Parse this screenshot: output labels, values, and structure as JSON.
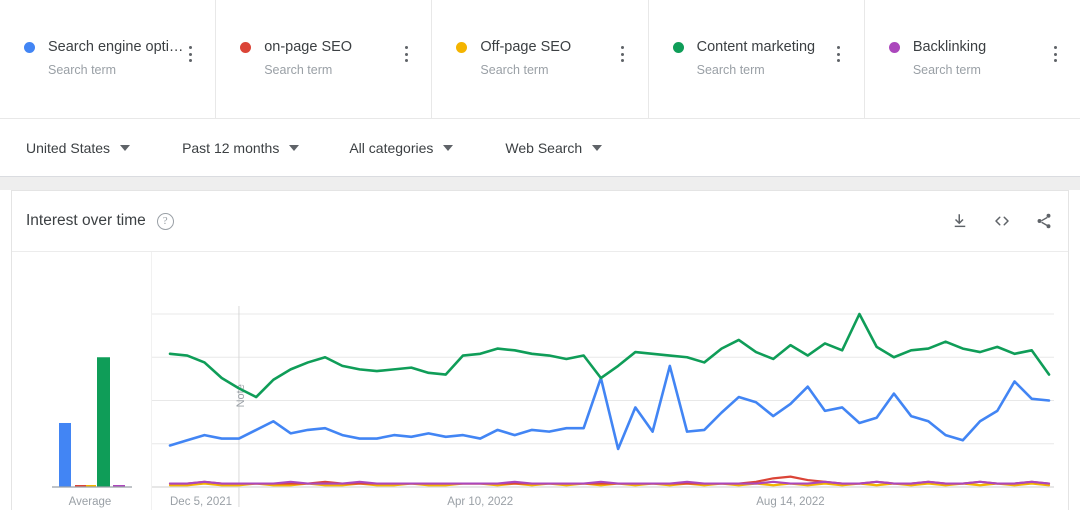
{
  "terms": [
    {
      "label": "Search engine opti…",
      "sublabel": "Search term",
      "color": "#4285f4"
    },
    {
      "label": "on-page SEO",
      "sublabel": "Search term",
      "color": "#db4437"
    },
    {
      "label": "Off-page SEO",
      "sublabel": "Search term",
      "color": "#f4b400"
    },
    {
      "label": "Content marketing",
      "sublabel": "Search term",
      "color": "#0f9d58"
    },
    {
      "label": "Backlinking",
      "sublabel": "Search term",
      "color": "#ab47bc"
    }
  ],
  "filters": [
    {
      "label": "United States",
      "name": "location-filter"
    },
    {
      "label": "Past 12 months",
      "name": "time-range-filter"
    },
    {
      "label": "All categories",
      "name": "category-filter"
    },
    {
      "label": "Web Search",
      "name": "search-type-filter"
    }
  ],
  "chart_panel": {
    "title": "Interest over time",
    "help_icon": "help-icon",
    "actions": [
      {
        "name": "download-icon",
        "label": "Download"
      },
      {
        "name": "embed-icon",
        "label": "Embed"
      },
      {
        "name": "share-icon",
        "label": "Share"
      }
    ]
  },
  "average_panel": {
    "axis_label": "Average",
    "values": [
      37,
      1,
      0.5,
      75,
      1
    ]
  },
  "chart_data": {
    "type": "line",
    "title": "Interest over time",
    "xlabel": "",
    "ylabel": "",
    "ylim": [
      0,
      100
    ],
    "yticks": [
      25,
      50,
      75,
      100
    ],
    "grid": true,
    "legend": "top-cards",
    "annotation": {
      "label": "Note",
      "x_index": 4
    },
    "xticks": [
      {
        "index": 0,
        "label": "Dec 5, 2021"
      },
      {
        "index": 18,
        "label": "Apr 10, 2022"
      },
      {
        "index": 36,
        "label": "Aug 14, 2022"
      }
    ],
    "x": [
      "Dec 5, 2021",
      "Dec 12, 2021",
      "Dec 19, 2021",
      "Dec 26, 2021",
      "Jan 2, 2022",
      "Jan 9, 2022",
      "Jan 16, 2022",
      "Jan 23, 2022",
      "Jan 30, 2022",
      "Feb 6, 2022",
      "Feb 13, 2022",
      "Feb 20, 2022",
      "Feb 27, 2022",
      "Mar 6, 2022",
      "Mar 13, 2022",
      "Mar 20, 2022",
      "Mar 27, 2022",
      "Apr 3, 2022",
      "Apr 10, 2022",
      "Apr 17, 2022",
      "Apr 24, 2022",
      "May 1, 2022",
      "May 8, 2022",
      "May 15, 2022",
      "May 22, 2022",
      "May 29, 2022",
      "Jun 5, 2022",
      "Jun 12, 2022",
      "Jun 19, 2022",
      "Jun 26, 2022",
      "Jul 3, 2022",
      "Jul 10, 2022",
      "Jul 17, 2022",
      "Jul 24, 2022",
      "Jul 31, 2022",
      "Aug 7, 2022",
      "Aug 14, 2022",
      "Aug 21, 2022",
      "Aug 28, 2022",
      "Sep 4, 2022",
      "Sep 11, 2022",
      "Sep 18, 2022",
      "Sep 25, 2022",
      "Oct 2, 2022",
      "Oct 9, 2022",
      "Oct 16, 2022",
      "Oct 23, 2022",
      "Oct 30, 2022",
      "Nov 6, 2022",
      "Nov 13, 2022",
      "Nov 20, 2022",
      "Nov 27, 2022"
    ],
    "series": [
      {
        "name": "Search engine opti…",
        "color": "#4285f4",
        "values": [
          24,
          27,
          30,
          28,
          28,
          33,
          38,
          31,
          33,
          34,
          30,
          28,
          28,
          30,
          29,
          31,
          29,
          30,
          28,
          33,
          30,
          33,
          32,
          34,
          34,
          63,
          22,
          46,
          32,
          70,
          32,
          33,
          43,
          52,
          49,
          41,
          48,
          58,
          44,
          46,
          37,
          40,
          54,
          41,
          38,
          30,
          27,
          38,
          44,
          61,
          51,
          50
        ]
      },
      {
        "name": "on-page SEO",
        "color": "#db4437",
        "values": [
          2,
          2,
          3,
          2,
          2,
          2,
          2,
          2,
          2,
          3,
          2,
          2,
          2,
          2,
          2,
          2,
          2,
          2,
          2,
          2,
          2,
          2,
          2,
          2,
          2,
          2,
          2,
          2,
          2,
          2,
          2,
          2,
          2,
          2,
          3,
          5,
          6,
          4,
          3,
          2,
          2,
          3,
          2,
          2,
          3,
          2,
          2,
          3,
          2,
          2,
          3,
          2
        ]
      },
      {
        "name": "Off-page SEO",
        "color": "#f4b400",
        "values": [
          1,
          1,
          2,
          1,
          1,
          2,
          1,
          1,
          2,
          1,
          1,
          2,
          1,
          1,
          2,
          1,
          1,
          2,
          2,
          1,
          2,
          1,
          2,
          1,
          2,
          1,
          2,
          1,
          2,
          1,
          2,
          1,
          2,
          1,
          2,
          1,
          2,
          1,
          2,
          1,
          2,
          1,
          2,
          1,
          2,
          1,
          2,
          1,
          2,
          1,
          2,
          1
        ]
      },
      {
        "name": "Content marketing",
        "color": "#0f9d58",
        "values": [
          77,
          76,
          72,
          63,
          57,
          52,
          62,
          68,
          72,
          75,
          70,
          68,
          67,
          68,
          69,
          66,
          65,
          76,
          77,
          80,
          79,
          77,
          76,
          74,
          76,
          63,
          70,
          78,
          77,
          76,
          75,
          72,
          80,
          85,
          78,
          74,
          82,
          76,
          83,
          79,
          100,
          81,
          75,
          79,
          80,
          84,
          80,
          78,
          81,
          77,
          79,
          65
        ]
      },
      {
        "name": "Backlinking",
        "color": "#ab47bc",
        "values": [
          2,
          2,
          3,
          2,
          2,
          2,
          2,
          3,
          2,
          2,
          2,
          3,
          2,
          2,
          2,
          2,
          2,
          2,
          2,
          2,
          3,
          2,
          2,
          2,
          2,
          3,
          2,
          2,
          2,
          2,
          3,
          2,
          2,
          2,
          2,
          3,
          2,
          2,
          3,
          2,
          2,
          3,
          2,
          2,
          3,
          2,
          2,
          3,
          2,
          2,
          3,
          2
        ]
      }
    ]
  }
}
